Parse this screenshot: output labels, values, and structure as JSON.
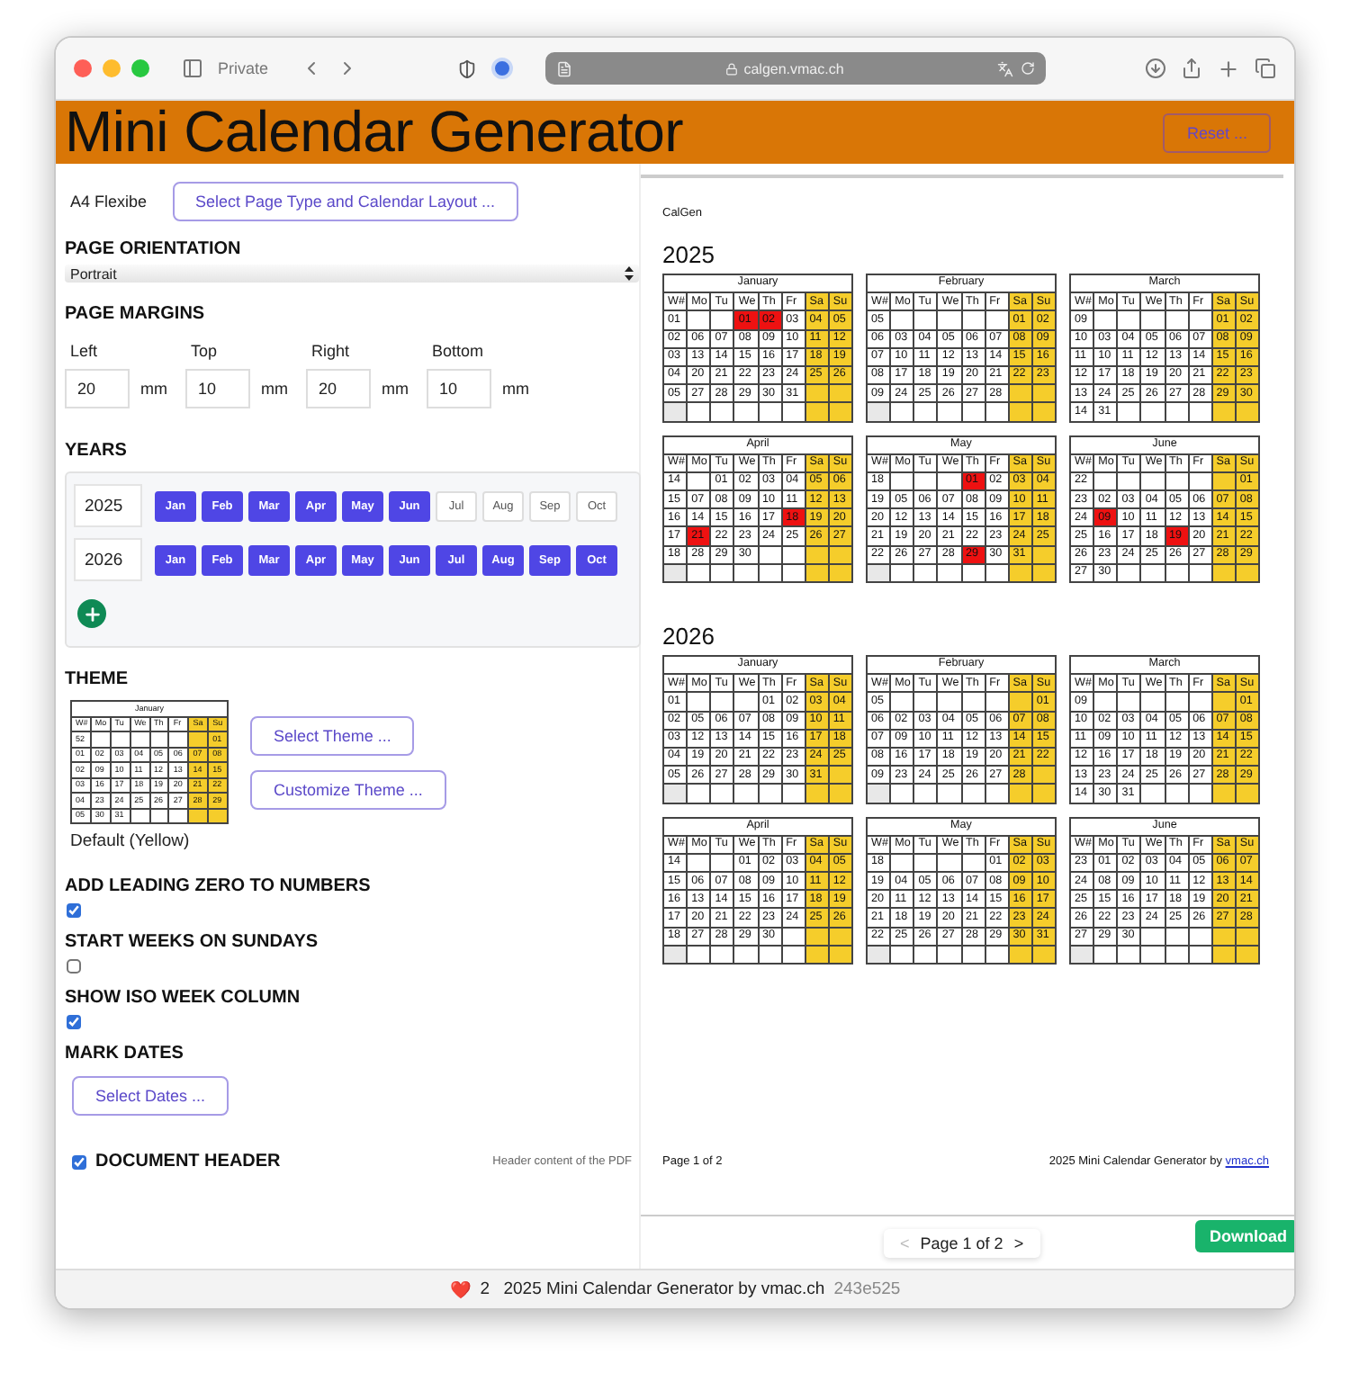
{
  "browser": {
    "tab_label": "Private",
    "url": "calgen.vmac.ch"
  },
  "header": {
    "title": "Mini Calendar Generator",
    "reset_button": "Reset ..."
  },
  "settings": {
    "page_type": {
      "label": "A4 Flexibe",
      "button": "Select Page Type and Calendar Layout ..."
    },
    "orientation": {
      "heading": "PAGE ORIENTATION",
      "value": "Portrait"
    },
    "margins": {
      "heading": "PAGE MARGINS",
      "fields": [
        {
          "label": "Left",
          "value": "20",
          "unit": "mm"
        },
        {
          "label": "Top",
          "value": "10",
          "unit": "mm"
        },
        {
          "label": "Right",
          "value": "20",
          "unit": "mm"
        },
        {
          "label": "Bottom",
          "value": "10",
          "unit": "mm"
        }
      ]
    },
    "years": {
      "heading": "YEARS",
      "rows": [
        {
          "year": "2025",
          "months": [
            {
              "label": "Jan",
              "selected": true
            },
            {
              "label": "Feb",
              "selected": true
            },
            {
              "label": "Mar",
              "selected": true
            },
            {
              "label": "Apr",
              "selected": true
            },
            {
              "label": "May",
              "selected": true
            },
            {
              "label": "Jun",
              "selected": true
            },
            {
              "label": "Jul",
              "selected": false
            },
            {
              "label": "Aug",
              "selected": false
            },
            {
              "label": "Sep",
              "selected": false
            },
            {
              "label": "Oct",
              "selected": false
            }
          ]
        },
        {
          "year": "2026",
          "months": [
            {
              "label": "Jan",
              "selected": true
            },
            {
              "label": "Feb",
              "selected": true
            },
            {
              "label": "Mar",
              "selected": true
            },
            {
              "label": "Apr",
              "selected": true
            },
            {
              "label": "May",
              "selected": true
            },
            {
              "label": "Jun",
              "selected": true
            },
            {
              "label": "Jul",
              "selected": true
            },
            {
              "label": "Aug",
              "selected": true
            },
            {
              "label": "Sep",
              "selected": true
            },
            {
              "label": "Oct",
              "selected": true
            }
          ]
        }
      ]
    },
    "theme": {
      "heading": "THEME",
      "preview": {
        "name": "January",
        "weekdays": [
          "W#",
          "Mo",
          "Tu",
          "We",
          "Th",
          "Fr",
          "Sa",
          "Su"
        ],
        "rows": [
          [
            "52",
            "",
            "",
            "",
            "",
            "",
            "",
            "01"
          ],
          [
            "01",
            "02",
            "03",
            "04",
            "05",
            "06",
            "07",
            "08"
          ],
          [
            "02",
            "09",
            "10",
            "11",
            "12",
            "13",
            "14",
            "15"
          ],
          [
            "03",
            "16",
            "17",
            "18",
            "19",
            "20",
            "21",
            "22"
          ],
          [
            "04",
            "23",
            "24",
            "25",
            "26",
            "27",
            "28",
            "29"
          ],
          [
            "05",
            "30",
            "31",
            "",
            "",
            "",
            "",
            ""
          ]
        ]
      },
      "name": "Default (Yellow)",
      "buttons": [
        "Select Theme ...",
        "Customize Theme ..."
      ]
    },
    "options": [
      {
        "heading": "ADD LEADING ZERO TO NUMBERS",
        "checked": true
      },
      {
        "heading": "START WEEKS ON SUNDAYS",
        "checked": false
      },
      {
        "heading": "SHOW ISO WEEK COLUMN",
        "checked": true
      }
    ],
    "mark_dates": {
      "heading": "MARK DATES",
      "button": "Select Dates ..."
    },
    "document_header": {
      "label": "DOCUMENT HEADER",
      "checked": true,
      "hint": "Header content of the PDF"
    }
  },
  "preview": {
    "brand": "CalGen",
    "years": [
      {
        "year": "2025",
        "months": [
          {
            "name": "January",
            "weekdays": [
              "W#",
              "Mo",
              "Tu",
              "We",
              "Th",
              "Fr",
              "Sa",
              "Su"
            ],
            "rows": [
              [
                "01",
                "",
                "",
                {
                  "text": "01",
                  "marked": true
                },
                {
                  "text": "02",
                  "marked": true
                },
                "03",
                "04",
                "05"
              ],
              [
                "02",
                "06",
                "07",
                "08",
                "09",
                "10",
                "11",
                "12"
              ],
              [
                "03",
                "13",
                "14",
                "15",
                "16",
                "17",
                "18",
                "19"
              ],
              [
                "04",
                "20",
                "21",
                "22",
                "23",
                "24",
                "25",
                "26"
              ],
              [
                "05",
                "27",
                "28",
                "29",
                "30",
                "31",
                "",
                ""
              ],
              [
                "",
                "",
                "",
                "",
                "",
                "",
                "",
                ""
              ]
            ]
          },
          {
            "name": "February",
            "weekdays": [
              "W#",
              "Mo",
              "Tu",
              "We",
              "Th",
              "Fr",
              "Sa",
              "Su"
            ],
            "rows": [
              [
                "05",
                "",
                "",
                "",
                "",
                "",
                "01",
                "02"
              ],
              [
                "06",
                "03",
                "04",
                "05",
                "06",
                "07",
                "08",
                "09"
              ],
              [
                "07",
                "10",
                "11",
                "12",
                "13",
                "14",
                "15",
                "16"
              ],
              [
                "08",
                "17",
                "18",
                "19",
                "20",
                "21",
                "22",
                "23"
              ],
              [
                "09",
                "24",
                "25",
                "26",
                "27",
                "28",
                "",
                ""
              ],
              [
                "",
                "",
                "",
                "",
                "",
                "",
                "",
                ""
              ]
            ]
          },
          {
            "name": "March",
            "weekdays": [
              "W#",
              "Mo",
              "Tu",
              "We",
              "Th",
              "Fr",
              "Sa",
              "Su"
            ],
            "rows": [
              [
                "09",
                "",
                "",
                "",
                "",
                "",
                "01",
                "02"
              ],
              [
                "10",
                "03",
                "04",
                "05",
                "06",
                "07",
                "08",
                "09"
              ],
              [
                "11",
                "10",
                "11",
                "12",
                "13",
                "14",
                "15",
                "16"
              ],
              [
                "12",
                "17",
                "18",
                "19",
                "20",
                "21",
                "22",
                "23"
              ],
              [
                "13",
                "24",
                "25",
                "26",
                "27",
                "28",
                "29",
                "30"
              ],
              [
                "14",
                "31",
                "",
                "",
                "",
                "",
                "",
                ""
              ]
            ]
          },
          {
            "name": "April",
            "weekdays": [
              "W#",
              "Mo",
              "Tu",
              "We",
              "Th",
              "Fr",
              "Sa",
              "Su"
            ],
            "rows": [
              [
                "14",
                "",
                "01",
                "02",
                "03",
                "04",
                "05",
                "06"
              ],
              [
                "15",
                "07",
                "08",
                "09",
                "10",
                "11",
                "12",
                "13"
              ],
              [
                "16",
                "14",
                "15",
                "16",
                "17",
                {
                  "text": "18",
                  "marked": true
                },
                "19",
                "20"
              ],
              [
                "17",
                {
                  "text": "21",
                  "marked": true
                },
                "22",
                "23",
                "24",
                "25",
                "26",
                "27"
              ],
              [
                "18",
                "28",
                "29",
                "30",
                "",
                "",
                "",
                ""
              ],
              [
                "",
                "",
                "",
                "",
                "",
                "",
                "",
                ""
              ]
            ]
          },
          {
            "name": "May",
            "weekdays": [
              "W#",
              "Mo",
              "Tu",
              "We",
              "Th",
              "Fr",
              "Sa",
              "Su"
            ],
            "rows": [
              [
                "18",
                "",
                "",
                "",
                {
                  "text": "01",
                  "marked": true
                },
                "02",
                "03",
                "04"
              ],
              [
                "19",
                "05",
                "06",
                "07",
                "08",
                "09",
                "10",
                "11"
              ],
              [
                "20",
                "12",
                "13",
                "14",
                "15",
                "16",
                "17",
                "18"
              ],
              [
                "21",
                "19",
                "20",
                "21",
                "22",
                "23",
                "24",
                "25"
              ],
              [
                "22",
                "26",
                "27",
                "28",
                {
                  "text": "29",
                  "marked": true
                },
                "30",
                "31",
                ""
              ],
              [
                "",
                "",
                "",
                "",
                "",
                "",
                "",
                ""
              ]
            ]
          },
          {
            "name": "June",
            "weekdays": [
              "W#",
              "Mo",
              "Tu",
              "We",
              "Th",
              "Fr",
              "Sa",
              "Su"
            ],
            "rows": [
              [
                "22",
                "",
                "",
                "",
                "",
                "",
                "",
                "01"
              ],
              [
                "23",
                "02",
                "03",
                "04",
                "05",
                "06",
                "07",
                "08"
              ],
              [
                "24",
                {
                  "text": "09",
                  "marked": true
                },
                "10",
                "11",
                "12",
                "13",
                "14",
                "15"
              ],
              [
                "25",
                "16",
                "17",
                "18",
                {
                  "text": "19",
                  "marked": true
                },
                "20",
                "21",
                "22"
              ],
              [
                "26",
                "23",
                "24",
                "25",
                "26",
                "27",
                "28",
                "29"
              ],
              [
                "27",
                "30",
                "",
                "",
                "",
                "",
                "",
                ""
              ]
            ]
          }
        ]
      },
      {
        "year": "2026",
        "months": [
          {
            "name": "January",
            "weekdays": [
              "W#",
              "Mo",
              "Tu",
              "We",
              "Th",
              "Fr",
              "Sa",
              "Su"
            ],
            "rows": [
              [
                "01",
                "",
                "",
                "",
                "01",
                "02",
                "03",
                "04"
              ],
              [
                "02",
                "05",
                "06",
                "07",
                "08",
                "09",
                "10",
                "11"
              ],
              [
                "03",
                "12",
                "13",
                "14",
                "15",
                "16",
                "17",
                "18"
              ],
              [
                "04",
                "19",
                "20",
                "21",
                "22",
                "23",
                "24",
                "25"
              ],
              [
                "05",
                "26",
                "27",
                "28",
                "29",
                "30",
                "31",
                ""
              ],
              [
                "",
                "",
                "",
                "",
                "",
                "",
                "",
                ""
              ]
            ]
          },
          {
            "name": "February",
            "weekdays": [
              "W#",
              "Mo",
              "Tu",
              "We",
              "Th",
              "Fr",
              "Sa",
              "Su"
            ],
            "rows": [
              [
                "05",
                "",
                "",
                "",
                "",
                "",
                "",
                "01"
              ],
              [
                "06",
                "02",
                "03",
                "04",
                "05",
                "06",
                "07",
                "08"
              ],
              [
                "07",
                "09",
                "10",
                "11",
                "12",
                "13",
                "14",
                "15"
              ],
              [
                "08",
                "16",
                "17",
                "18",
                "19",
                "20",
                "21",
                "22"
              ],
              [
                "09",
                "23",
                "24",
                "25",
                "26",
                "27",
                "28",
                ""
              ],
              [
                "",
                "",
                "",
                "",
                "",
                "",
                "",
                ""
              ]
            ]
          },
          {
            "name": "March",
            "weekdays": [
              "W#",
              "Mo",
              "Tu",
              "We",
              "Th",
              "Fr",
              "Sa",
              "Su"
            ],
            "rows": [
              [
                "09",
                "",
                "",
                "",
                "",
                "",
                "",
                "01"
              ],
              [
                "10",
                "02",
                "03",
                "04",
                "05",
                "06",
                "07",
                "08"
              ],
              [
                "11",
                "09",
                "10",
                "11",
                "12",
                "13",
                "14",
                "15"
              ],
              [
                "12",
                "16",
                "17",
                "18",
                "19",
                "20",
                "21",
                "22"
              ],
              [
                "13",
                "23",
                "24",
                "25",
                "26",
                "27",
                "28",
                "29"
              ],
              [
                "14",
                "30",
                "31",
                "",
                "",
                "",
                "",
                ""
              ]
            ]
          },
          {
            "name": "April",
            "weekdays": [
              "W#",
              "Mo",
              "Tu",
              "We",
              "Th",
              "Fr",
              "Sa",
              "Su"
            ],
            "rows": [
              [
                "14",
                "",
                "",
                "01",
                "02",
                "03",
                "04",
                "05"
              ],
              [
                "15",
                "06",
                "07",
                "08",
                "09",
                "10",
                "11",
                "12"
              ],
              [
                "16",
                "13",
                "14",
                "15",
                "16",
                "17",
                "18",
                "19"
              ],
              [
                "17",
                "20",
                "21",
                "22",
                "23",
                "24",
                "25",
                "26"
              ],
              [
                "18",
                "27",
                "28",
                "29",
                "30",
                "",
                "",
                ""
              ],
              [
                "",
                "",
                "",
                "",
                "",
                "",
                "",
                ""
              ]
            ]
          },
          {
            "name": "May",
            "weekdays": [
              "W#",
              "Mo",
              "Tu",
              "We",
              "Th",
              "Fr",
              "Sa",
              "Su"
            ],
            "rows": [
              [
                "18",
                "",
                "",
                "",
                "",
                "01",
                "02",
                "03"
              ],
              [
                "19",
                "04",
                "05",
                "06",
                "07",
                "08",
                "09",
                "10"
              ],
              [
                "20",
                "11",
                "12",
                "13",
                "14",
                "15",
                "16",
                "17"
              ],
              [
                "21",
                "18",
                "19",
                "20",
                "21",
                "22",
                "23",
                "24"
              ],
              [
                "22",
                "25",
                "26",
                "27",
                "28",
                "29",
                "30",
                "31"
              ],
              [
                "",
                "",
                "",
                "",
                "",
                "",
                "",
                ""
              ]
            ]
          },
          {
            "name": "June",
            "weekdays": [
              "W#",
              "Mo",
              "Tu",
              "We",
              "Th",
              "Fr",
              "Sa",
              "Su"
            ],
            "rows": [
              [
                "23",
                "01",
                "02",
                "03",
                "04",
                "05",
                "06",
                "07"
              ],
              [
                "24",
                "08",
                "09",
                "10",
                "11",
                "12",
                "13",
                "14"
              ],
              [
                "25",
                "15",
                "16",
                "17",
                "18",
                "19",
                "20",
                "21"
              ],
              [
                "26",
                "22",
                "23",
                "24",
                "25",
                "26",
                "27",
                "28"
              ],
              [
                "27",
                "29",
                "30",
                "",
                "",
                "",
                "",
                ""
              ],
              [
                "",
                "",
                "",
                "",
                "",
                "",
                "",
                ""
              ]
            ]
          }
        ]
      }
    ],
    "footer_left": "Page 1 of 2",
    "footer_right": {
      "text": "2025 Mini Calendar Generator by",
      "link": "vmac.ch"
    }
  },
  "pager": {
    "prev": "<",
    "label": "Page 1 of 2",
    "next": ">"
  },
  "download_button": "Download",
  "status_bar": {
    "heart": "❤️",
    "count": "2",
    "text": "2025 Mini Calendar Generator by vmac.ch",
    "hash": "243e525"
  }
}
